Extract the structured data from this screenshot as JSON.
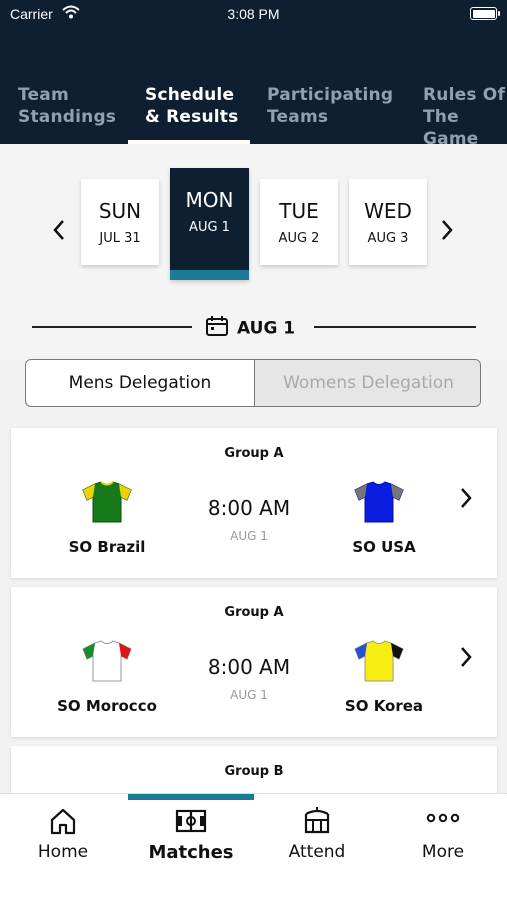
{
  "status": {
    "carrier": "Carrier",
    "time": "3:08 PM"
  },
  "tabs": [
    {
      "label": "Team\nStandings"
    },
    {
      "label": "Schedule\n& Results"
    },
    {
      "label": "Participating\nTeams"
    },
    {
      "label": "Rules Of\nThe Game"
    }
  ],
  "days": [
    {
      "name": "SUN",
      "date": "JUL 31"
    },
    {
      "name": "MON",
      "date": "AUG 1"
    },
    {
      "name": "TUE",
      "date": "AUG 2"
    },
    {
      "name": "WED",
      "date": "AUG 3"
    }
  ],
  "selected_date": "AUG 1",
  "segment": {
    "mens": "Mens Delegation",
    "womens": "Womens Delegation"
  },
  "matches": [
    {
      "group": "Group A",
      "time": "8:00 AM",
      "date": "AUG 1",
      "home": "SO Brazil",
      "away": "SO USA"
    },
    {
      "group": "Group A",
      "time": "8:00 AM",
      "date": "AUG 1",
      "home": "SO Morocco",
      "away": "SO Korea"
    },
    {
      "group": "Group B"
    }
  ],
  "nav": {
    "home": "Home",
    "matches": "Matches",
    "attend": "Attend",
    "more": "More"
  },
  "colors": {
    "header": "#0d1f30",
    "accent": "#1b7a96"
  },
  "icons": [
    "wifi-icon",
    "battery-icon",
    "chevron-left-icon",
    "chevron-right-icon",
    "calendar-icon",
    "jersey-icon",
    "home-icon",
    "pitch-icon",
    "stadium-icon",
    "more-dots-icon"
  ]
}
